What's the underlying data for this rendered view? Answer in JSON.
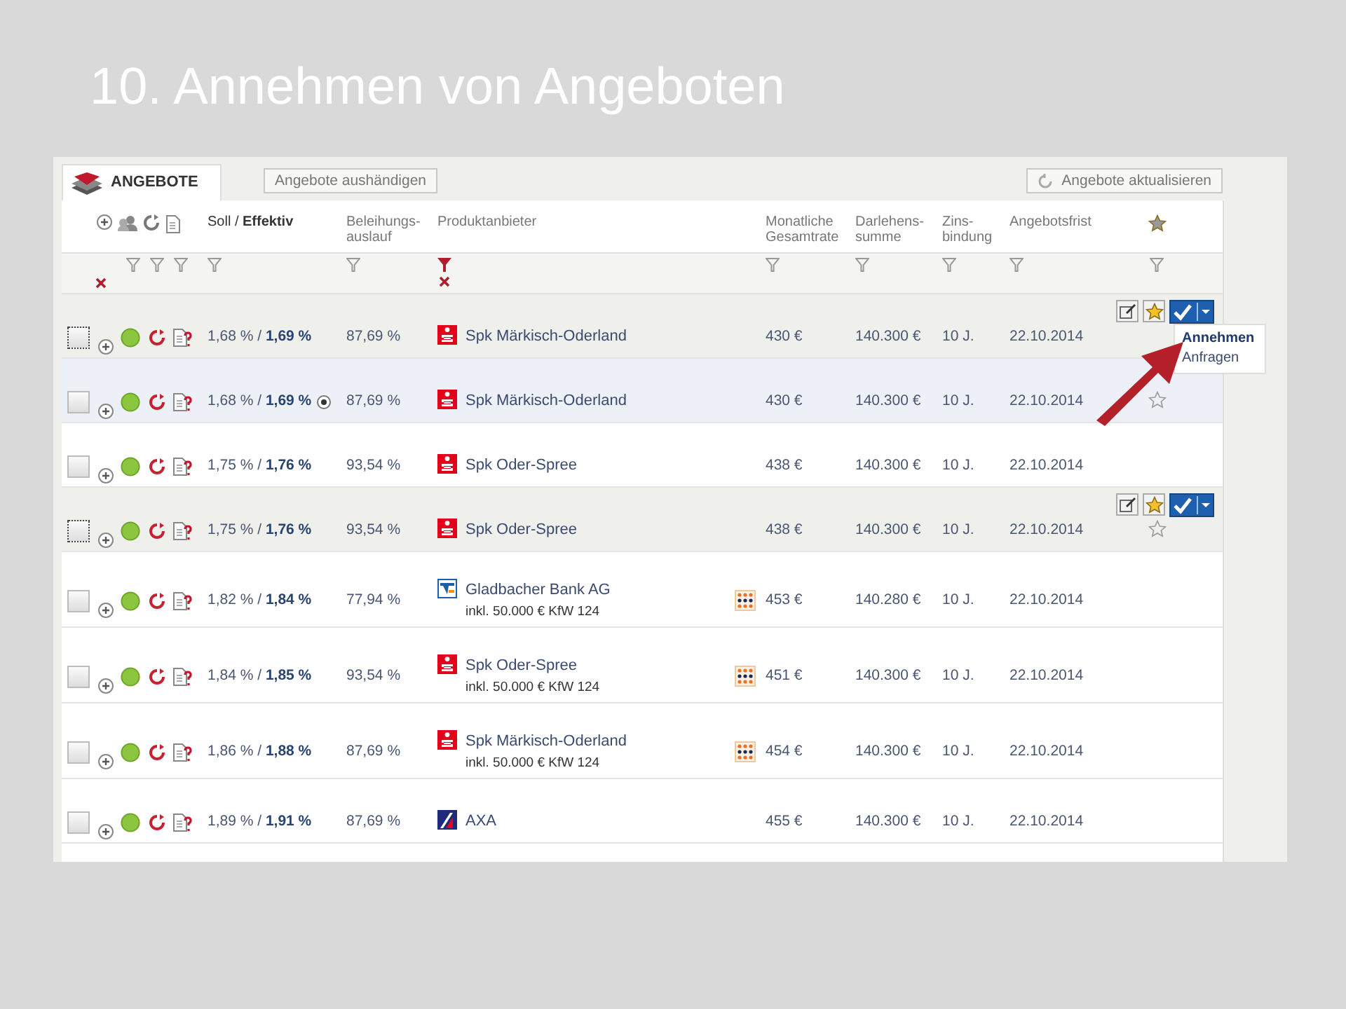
{
  "slide_title": "10. Annehmen von Angeboten",
  "tab": {
    "label": "ANGEBOTE",
    "selected": true
  },
  "buttons": [
    {
      "label": "Angebote aushändigen",
      "kind": "plain"
    },
    {
      "label": "Angebote aktualisieren",
      "kind": "refresh"
    }
  ],
  "clear_all_filters": true,
  "columns": [
    {
      "kind": "icons",
      "filters": [
        {
          "active": false
        },
        {
          "active": false
        },
        {
          "active": false
        }
      ]
    },
    {
      "kind": "text",
      "label": [
        "Soll / **Effektiv**"
      ],
      "filter_active": false
    },
    {
      "kind": "text",
      "label": [
        "Beleihungs-",
        "auslauf"
      ],
      "filter_active": false
    },
    {
      "kind": "text",
      "label": [
        "Produktanbieter"
      ],
      "filter_active": true
    },
    {
      "kind": "spacer"
    },
    {
      "kind": "text",
      "label": [
        "Monatliche",
        "Gesamtrate"
      ],
      "filter_active": false
    },
    {
      "kind": "text",
      "label": [
        "Darlehens-",
        "summe"
      ],
      "filter_active": false
    },
    {
      "kind": "text",
      "label": [
        "Zins-",
        "bindung"
      ],
      "filter_active": false
    },
    {
      "kind": "text",
      "label": [
        "Angebotsfrist"
      ],
      "filter_active": false
    },
    {
      "kind": "star",
      "filter_active": false
    }
  ],
  "rows": [
    {
      "checked": false,
      "hovered": true,
      "selected": false,
      "rate": "1,68 % / **1,69 %**",
      "compare_mark": false,
      "ltv": "87,69 %",
      "logo": {
        "kind": "sparkasse"
      },
      "provider": "Spk Märkisch-Oderland",
      "kfw": false,
      "monthly": "430 €",
      "amount": "140.300 €",
      "term": "10 J.",
      "deadline": "22.10.2014",
      "show_star": false,
      "menu": [
        {
          "label": "Annehmen",
          "selected": true
        },
        {
          "label": "Anfragen",
          "selected": false
        }
      ]
    },
    {
      "checked": false,
      "hovered": false,
      "selected": true,
      "rate": "1,68 % / **1,69 %**",
      "compare_mark": true,
      "ltv": "87,69 %",
      "logo": {
        "kind": "sparkasse"
      },
      "provider": "Spk Märkisch-Oderland",
      "kfw": false,
      "monthly": "430 €",
      "amount": "140.300 €",
      "term": "10 J.",
      "deadline": "22.10.2014",
      "show_star": true
    },
    {
      "checked": false,
      "hovered": false,
      "selected": false,
      "rate": "1,75 % / **1,76 %**",
      "compare_mark": false,
      "ltv": "93,54 %",
      "logo": {
        "kind": "sparkasse"
      },
      "provider": "Spk Oder-Spree",
      "kfw": false,
      "monthly": "438 €",
      "amount": "140.300 €",
      "term": "10 J.",
      "deadline": "22.10.2014",
      "show_star": false
    },
    {
      "checked": false,
      "hovered": true,
      "selected": false,
      "rate": "1,75 % / **1,76 %**",
      "compare_mark": false,
      "ltv": "93,54 %",
      "logo": {
        "kind": "sparkasse"
      },
      "provider": "Spk Oder-Spree",
      "kfw": false,
      "monthly": "438 €",
      "amount": "140.300 €",
      "term": "10 J.",
      "deadline": "22.10.2014",
      "show_star": true
    },
    {
      "checked": false,
      "hovered": false,
      "selected": false,
      "rate": "1,82 % / **1,84 %**",
      "compare_mark": false,
      "ltv": "77,94 %",
      "logo": {
        "kind": "vr"
      },
      "provider": "Gladbacher Bank AG",
      "note": "inkl. 50.000 € KfW 124",
      "kfw": true,
      "monthly": "453 €",
      "amount": "140.280 €",
      "term": "10 J.",
      "deadline": "22.10.2014",
      "show_star": false
    },
    {
      "checked": false,
      "hovered": false,
      "selected": false,
      "rate": "1,84 % / **1,85 %**",
      "compare_mark": false,
      "ltv": "93,54 %",
      "logo": {
        "kind": "sparkasse"
      },
      "provider": "Spk Oder-Spree",
      "note": "inkl. 50.000 € KfW 124",
      "kfw": true,
      "monthly": "451 €",
      "amount": "140.300 €",
      "term": "10 J.",
      "deadline": "22.10.2014",
      "show_star": false
    },
    {
      "checked": false,
      "hovered": false,
      "selected": false,
      "rate": "1,86 % / **1,88 %**",
      "compare_mark": false,
      "ltv": "87,69 %",
      "logo": {
        "kind": "sparkasse"
      },
      "provider": "Spk Märkisch-Oderland",
      "note": "inkl. 50.000 € KfW 124",
      "kfw": true,
      "monthly": "454 €",
      "amount": "140.300 €",
      "term": "10 J.",
      "deadline": "22.10.2014",
      "show_star": false
    },
    {
      "checked": false,
      "hovered": false,
      "selected": false,
      "rate": "1,89 % / **1,91 %**",
      "compare_mark": false,
      "ltv": "87,69 %",
      "logo": {
        "kind": "axa"
      },
      "provider": "AXA",
      "kfw": false,
      "monthly": "455 €",
      "amount": "140.300 €",
      "term": "10 J.",
      "deadline": "22.10.2014",
      "show_star": false
    }
  ],
  "annotation": {
    "kind": "arrow"
  }
}
